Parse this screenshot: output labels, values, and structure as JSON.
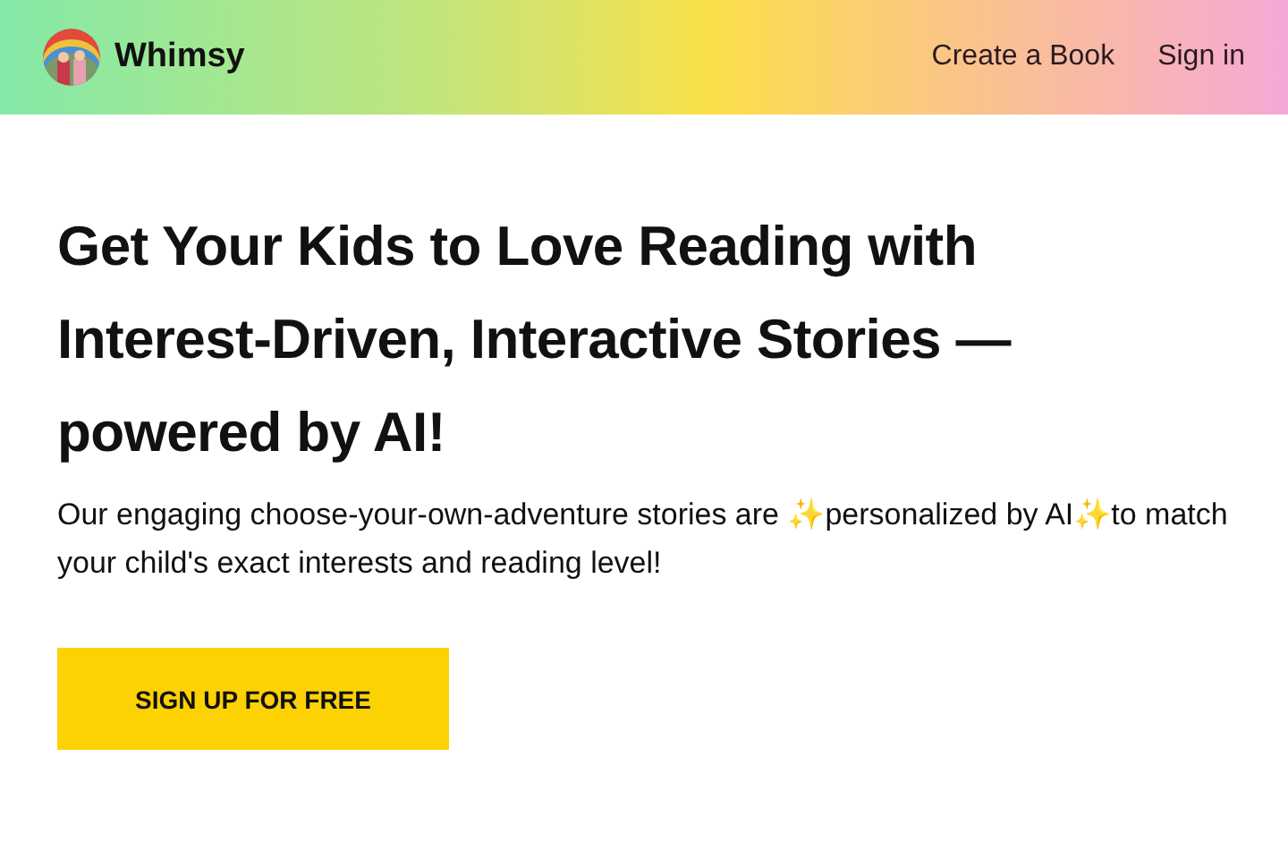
{
  "header": {
    "brand": "Whimsy",
    "nav": [
      "Create a Book",
      "Sign in"
    ]
  },
  "hero": {
    "heading": "Get Your Kids to Love Reading with Interest-Driven, Interactive Stories — powered by AI!",
    "text": "Our engaging choose-your-own-adventure stories are ✨personalized by AI✨to match your child's exact interests and reading level!",
    "button": "SIGN UP FOR FREE"
  }
}
